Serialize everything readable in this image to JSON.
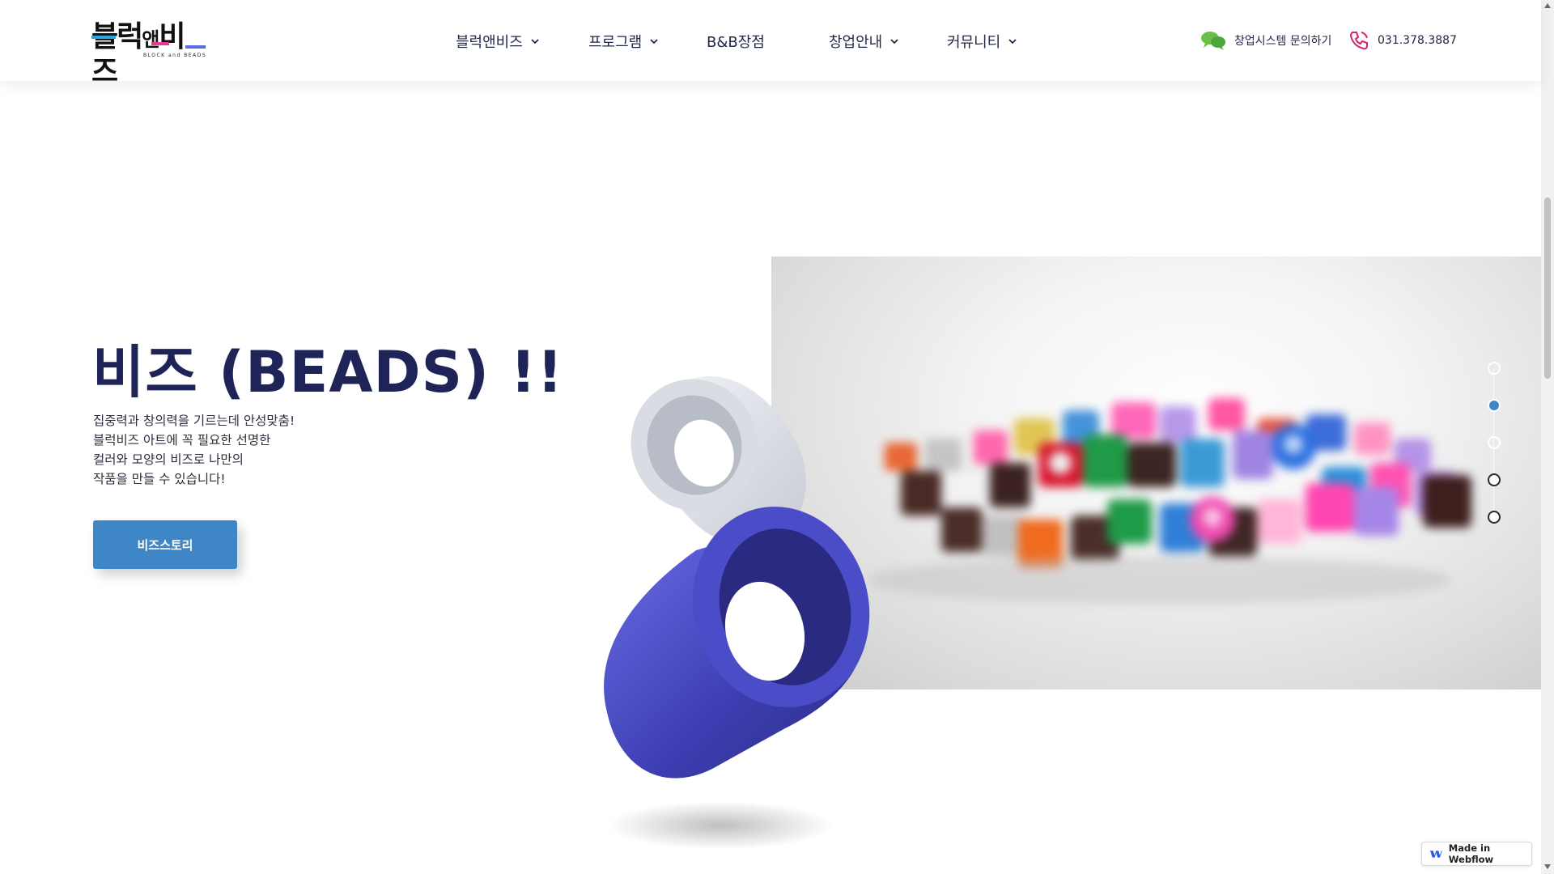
{
  "brand": {
    "logo_text_1": "블럭",
    "logo_text_2": "앤",
    "logo_text_3": "비즈",
    "logo_sub": "BLOCK and BEADS",
    "colors": [
      "#e8388f",
      "#2aa6df",
      "#f2c12e",
      "#5b6be8"
    ]
  },
  "nav": {
    "items": [
      {
        "label": "블럭앤비즈",
        "has_dropdown": true
      },
      {
        "label": "프로그램",
        "has_dropdown": true
      },
      {
        "label": "B&B장점",
        "has_dropdown": false
      },
      {
        "label": "창업안내",
        "has_dropdown": true
      },
      {
        "label": "커뮤니티",
        "has_dropdown": true
      }
    ]
  },
  "contact": {
    "inquiry_label": "창업시스템 문의하기",
    "inquiry_icon": "chat-bubbles-icon",
    "phone_label": "031.378.3887",
    "phone_icon": "phone-icon"
  },
  "hero": {
    "title": "비즈 (BEADS) !!",
    "desc_lines": [
      "집중력과 창의력을 기르는데 안성맞춤!",
      "블럭비즈 아트에 꼭 필요한 선명한",
      "컬러와 모양의 비즈로 나만의",
      "작품을 만들 수 있습니다!"
    ],
    "cta_label": "비즈스토리"
  },
  "slider": {
    "count": 5,
    "active_index": 1
  },
  "colors": {
    "accent": "#3f86c6",
    "title": "#1f2458",
    "bead_blue": "#4f4fc7"
  },
  "webflow_badge": "Made in Webflow"
}
